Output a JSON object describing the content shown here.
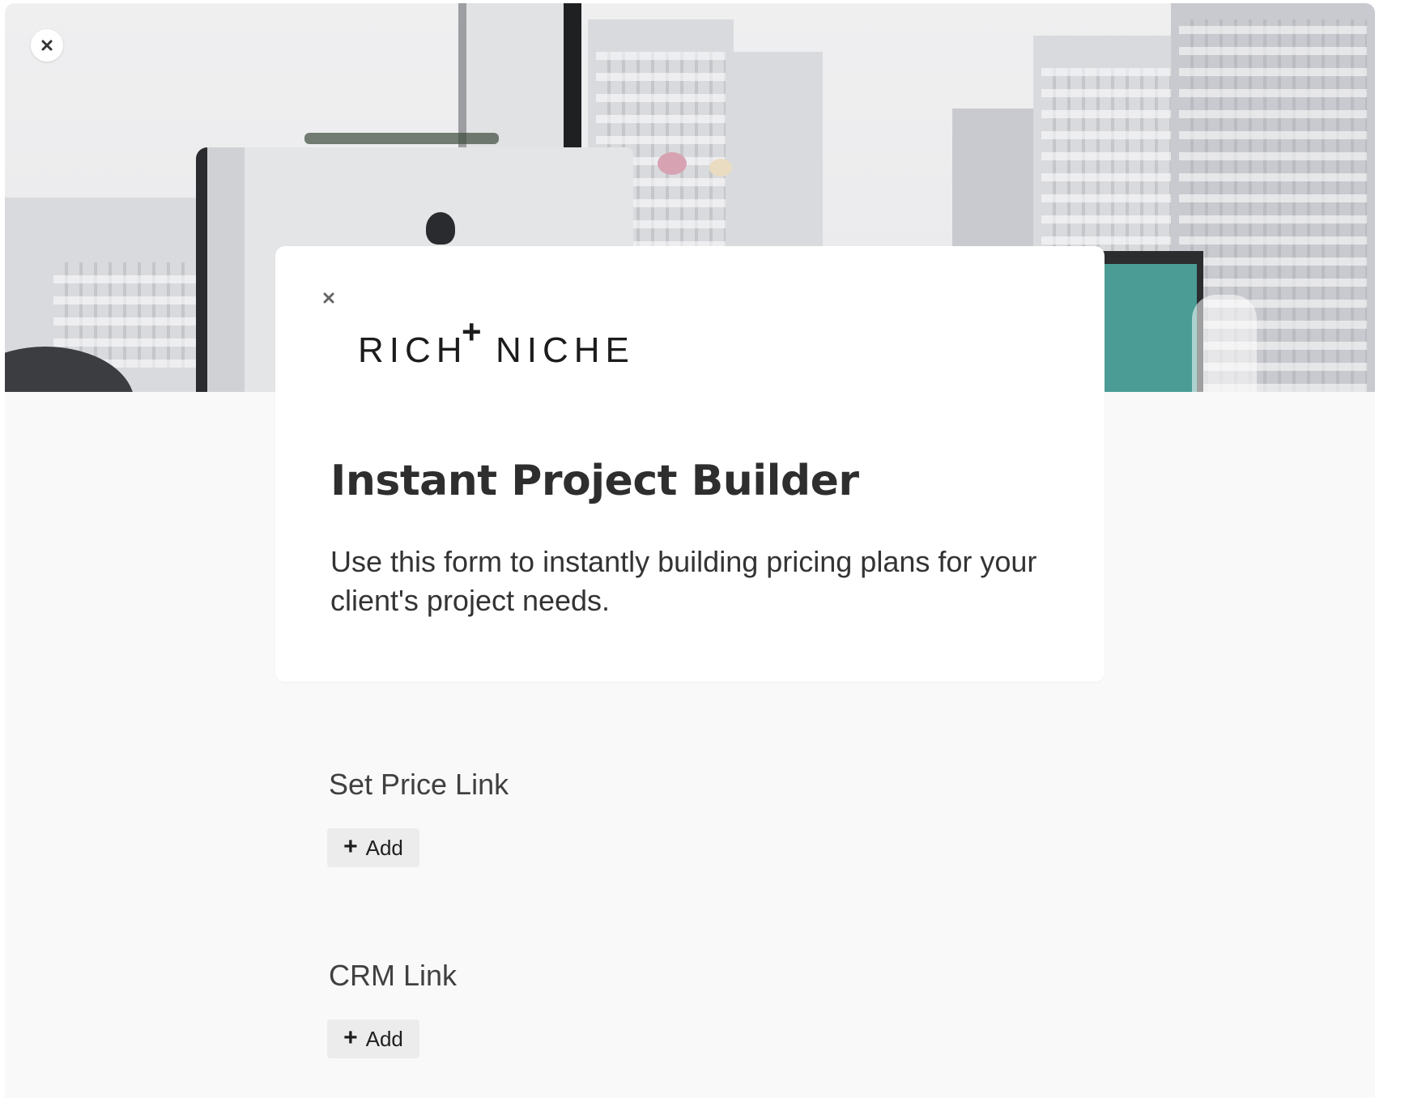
{
  "cover": {
    "close_icon": "close-icon"
  },
  "card": {
    "close_icon": "close-icon",
    "logo": {
      "word_left": "RICH",
      "plus": "+",
      "word_right": "NICHE"
    },
    "title": "Instant Project Builder",
    "description": "Use this form to instantly building pricing plans for your client's project needs."
  },
  "sections": [
    {
      "title": "Set Price Link",
      "add_label": "Add",
      "add_icon": "plus-icon"
    },
    {
      "title": "CRM Link",
      "add_label": "Add",
      "add_icon": "plus-icon"
    }
  ]
}
